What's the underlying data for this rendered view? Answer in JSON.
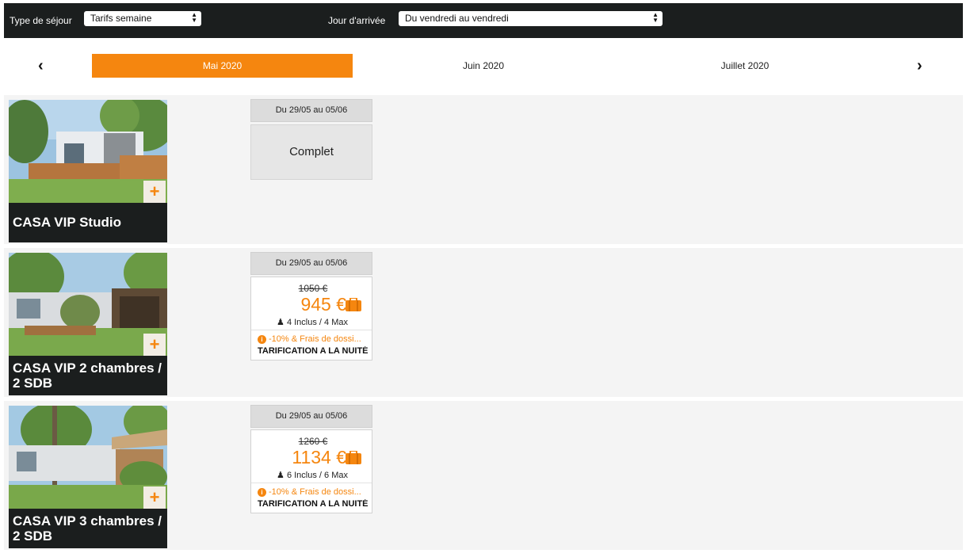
{
  "filters": {
    "stay_type_label": "Type de séjour",
    "stay_type_value": "Tarifs semaine",
    "arrival_label": "Jour d'arrivée",
    "arrival_value": "Du vendredi au vendredi"
  },
  "months": {
    "prev_icon": "chevron-left-icon",
    "next_icon": "chevron-right-icon",
    "items": [
      {
        "label": "Mai 2020",
        "active": true
      },
      {
        "label": "Juin 2020",
        "active": false
      },
      {
        "label": "Juillet 2020",
        "active": false
      }
    ]
  },
  "colors": {
    "accent": "#f5860f",
    "bar": "#1b1e1e",
    "row_bg": "#f4f4f4"
  },
  "listings": [
    {
      "title": "CASA VIP Studio",
      "date_range": "Du 29/05 au 05/06",
      "status": "Complet"
    },
    {
      "title": "CASA VIP 2 chambres / 2 SDB",
      "date_range": "Du 29/05 au 05/06",
      "old_price": "1050 €",
      "price": "945 €",
      "persons": "4 Inclus / 4 Max",
      "promo": "-10% & Frais de dossi...",
      "pricing_note": "TARIFICATION A LA NUITÉ"
    },
    {
      "title": "CASA VIP 3 chambres / 2 SDB",
      "date_range": "Du 29/05 au 05/06",
      "old_price": "1260 €",
      "price": "1134 €",
      "persons": "6 Inclus / 6 Max",
      "promo": "-10% & Frais de dossi...",
      "pricing_note": "TARIFICATION A LA NUITÉ"
    }
  ]
}
